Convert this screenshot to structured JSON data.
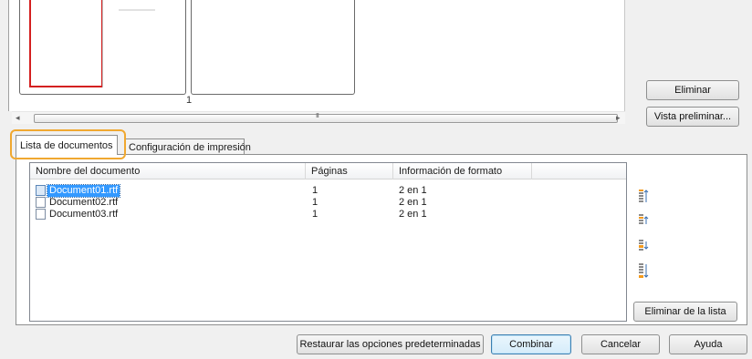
{
  "preview": {
    "page_number": "1"
  },
  "side_buttons": {
    "delete": "Eliminar",
    "preview": "Vista preliminar..."
  },
  "scrollbar": {
    "left_arrow": "◂",
    "right_arrow": "▸",
    "grip": "III"
  },
  "tabs": [
    {
      "label": "Lista de documentos",
      "selected": true
    },
    {
      "label": "Configuración de impresión",
      "selected": false
    }
  ],
  "table": {
    "columns": [
      "Nombre del documento",
      "Páginas",
      "Información de formato",
      ""
    ],
    "rows": [
      {
        "name": "Document01.rtf",
        "pages": "1",
        "format": "2 en 1",
        "selected": true
      },
      {
        "name": "Document02.rtf",
        "pages": "1",
        "format": "2 en 1",
        "selected": false
      },
      {
        "name": "Document03.rtf",
        "pages": "1",
        "format": "2 en 1",
        "selected": false
      }
    ]
  },
  "order_icons": [
    "move-to-top-icon",
    "move-up-icon",
    "move-down-icon",
    "move-to-bottom-icon"
  ],
  "list_buttons": {
    "remove_from_list": "Eliminar de la lista"
  },
  "footer": {
    "restore": "Restaurar las opciones predeterminadas",
    "combine": "Combinar",
    "cancel": "Cancelar",
    "help": "Ayuda"
  },
  "colors": {
    "highlight_frame": "#f0a830",
    "selection": "#3399ff",
    "preview_border": "#d42020"
  }
}
